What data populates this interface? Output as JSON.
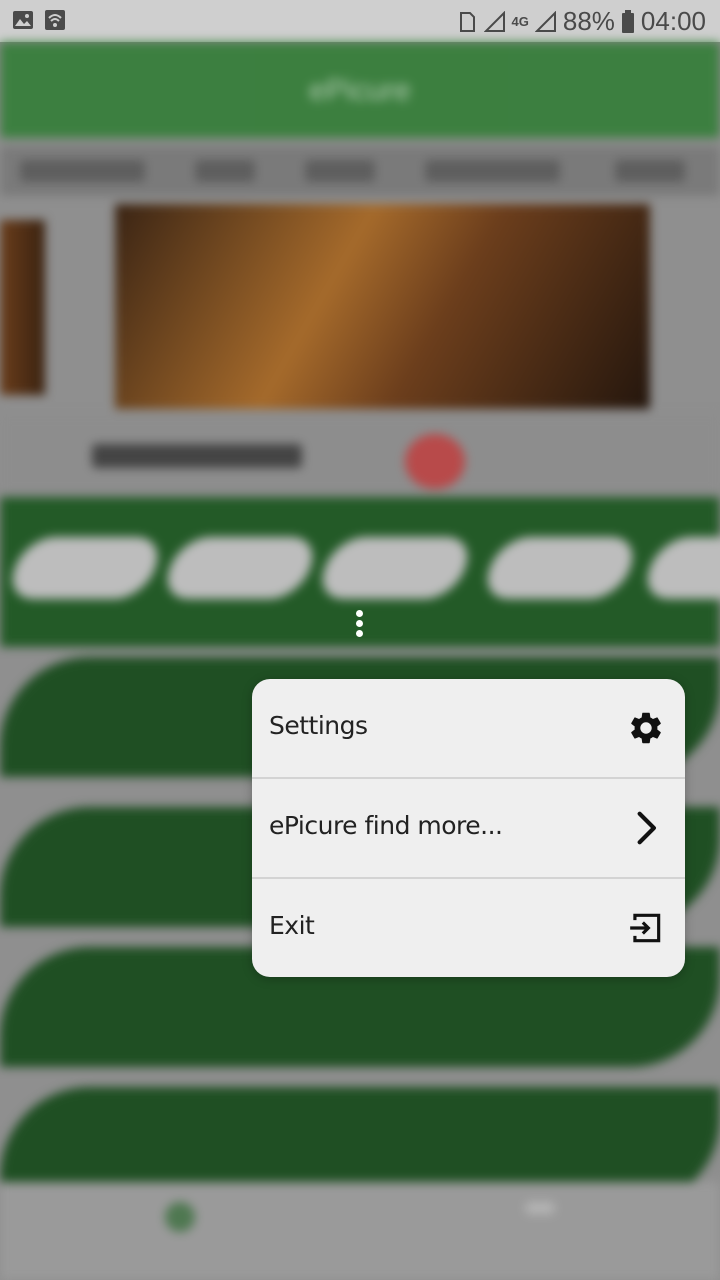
{
  "status_bar": {
    "battery": "88%",
    "time": "04:00",
    "network": "4G"
  },
  "background_app": {
    "title": "ePicure"
  },
  "menu": {
    "items": [
      {
        "label": "Settings",
        "icon": "gear-icon"
      },
      {
        "label": "ePicure find more...",
        "icon": "chevron-right-icon"
      },
      {
        "label": "Exit",
        "icon": "exit-icon"
      }
    ]
  },
  "colors": {
    "brand_green": "#2e7d32",
    "menu_bg": "#efefef"
  }
}
